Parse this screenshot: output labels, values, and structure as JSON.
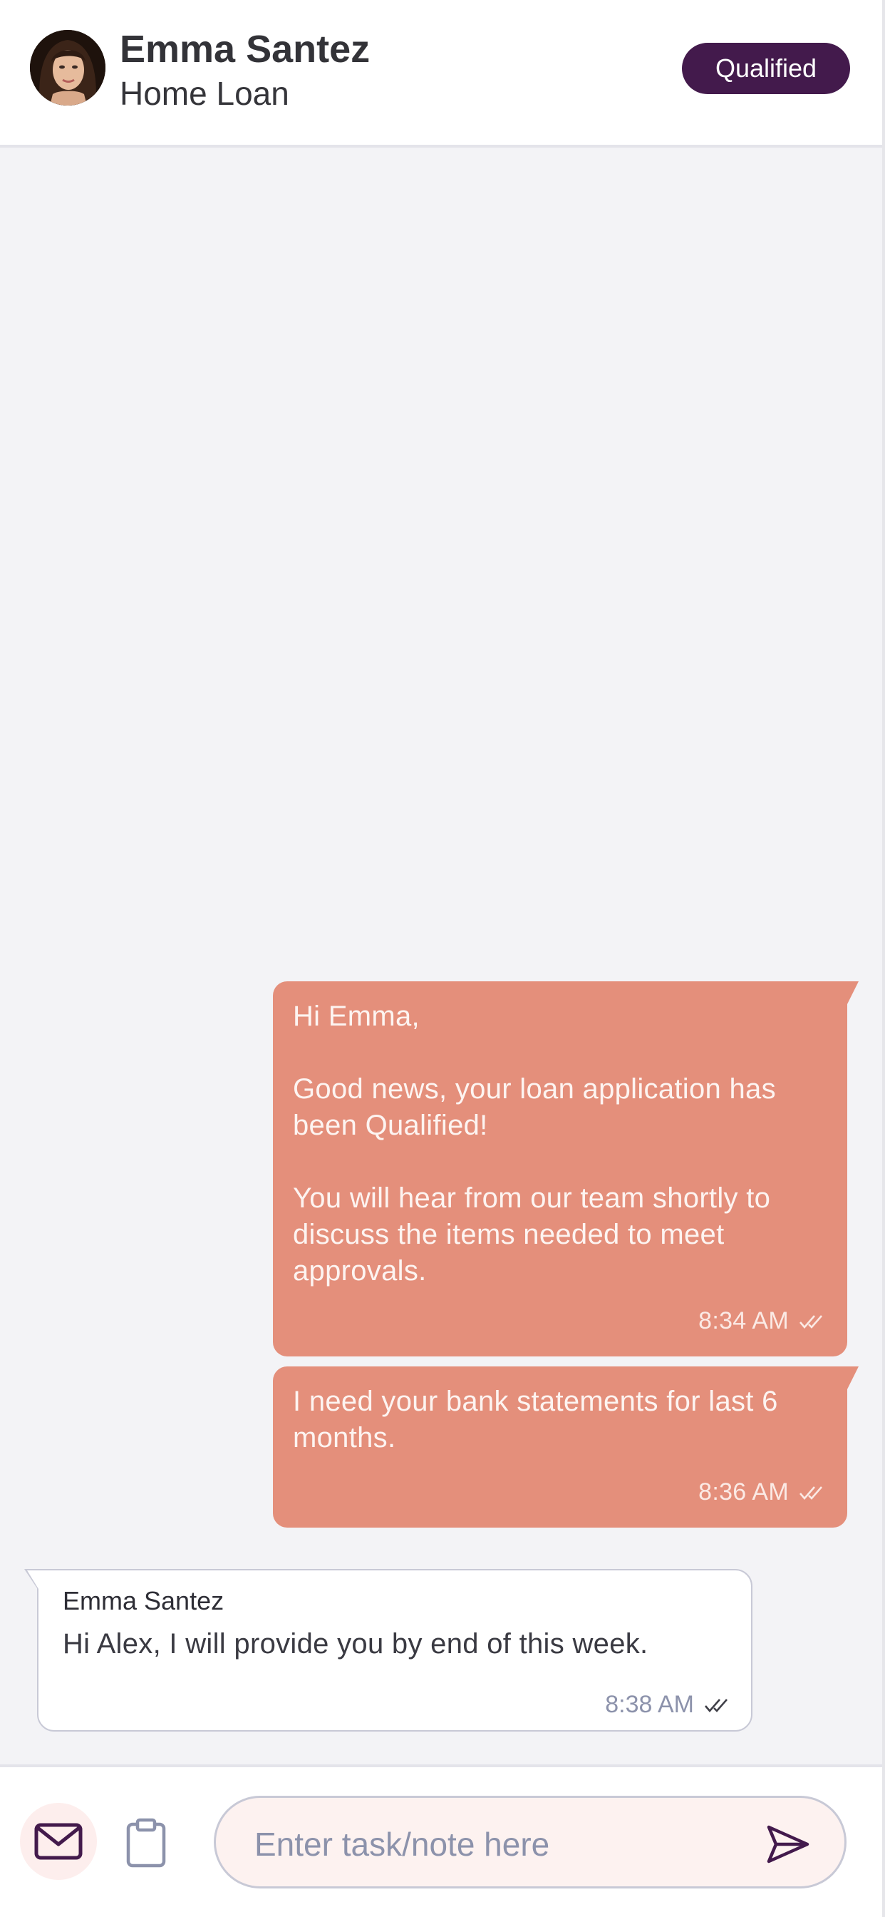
{
  "header": {
    "contact_name": "Emma Santez",
    "loan_type": "Home Loan",
    "status": "Qualified"
  },
  "messages": [
    {
      "direction": "outgoing",
      "text": "Hi Emma,\n\nGood news, your loan application has been Qualified!\n\nYou will hear from our team shortly to discuss the items needed to meet approvals.",
      "time": "8:34 AM",
      "read_icon": "double-check-icon"
    },
    {
      "direction": "outgoing",
      "text": "I need your bank statements for last 6 months.",
      "time": "8:36 AM",
      "read_icon": "double-check-icon"
    },
    {
      "direction": "incoming",
      "sender": "Emma Santez",
      "text": "Hi Alex, I will provide you by end of this week.",
      "time": "8:38 AM",
      "read_icon": "double-check-icon"
    }
  ],
  "composer": {
    "placeholder": "Enter task/note here",
    "mail_icon": "mail-icon",
    "clipboard_icon": "clipboard-icon",
    "send_icon": "send-icon"
  },
  "colors": {
    "badge": "#431a4c",
    "outgoing_bubble": "#e48f7b",
    "background": "#f3f3f6",
    "mail_button_bg": "#fdeeed",
    "input_bg": "#fdf2f0"
  }
}
